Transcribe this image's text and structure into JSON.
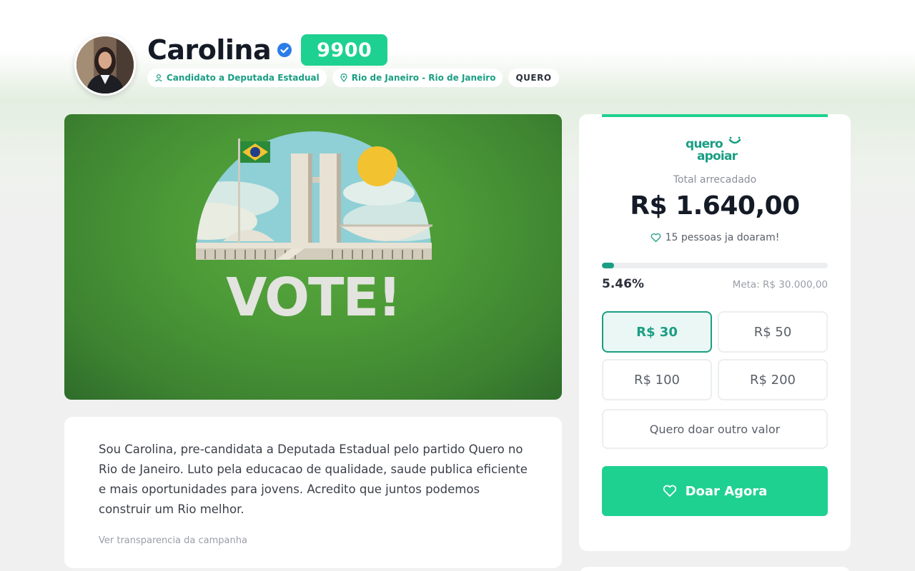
{
  "candidate": {
    "name": "Carolina",
    "number": "9900",
    "role": "Candidato a Deputada Estadual",
    "location": "Rio de Janeiro - Rio de Janeiro",
    "party": "QUERO"
  },
  "banner": {
    "headline": "VOTE!"
  },
  "bio": {
    "text": "Sou Carolina, pre-candidata a Deputada Estadual pelo partido Quero no Rio de Janeiro. Luto pela educacao de qualidade, saude publica eficiente e mais oportunidades para jovens. Acredito que juntos podemos construir um Rio melhor.",
    "transparency_link": "Ver transparencia da campanha"
  },
  "donation": {
    "logo_text_top": "quero",
    "logo_text_bottom": "apoiar",
    "total_label": "Total arrecadado",
    "total_value": "R$ 1.640,00",
    "donors_text": "15 pessoas ja doaram!",
    "progress_percent_label": "5.46%",
    "progress_fraction": 0.0546,
    "goal_label": "Meta: R$ 30.000,00",
    "amounts": [
      "R$ 30",
      "R$ 50",
      "R$ 100",
      "R$ 200"
    ],
    "selected_amount_index": 0,
    "other_amount_label": "Quero doar outro valor",
    "donate_button_label": "Doar Agora"
  },
  "colors": {
    "accent": "#1fd191",
    "accent_dark": "#1a9e84",
    "banner_green": "#4c9a37"
  },
  "icons": {
    "verified": "verified-check-icon",
    "role": "person-icon",
    "location": "map-pin-icon",
    "donors": "heart-icon",
    "donate": "heart-icon"
  }
}
